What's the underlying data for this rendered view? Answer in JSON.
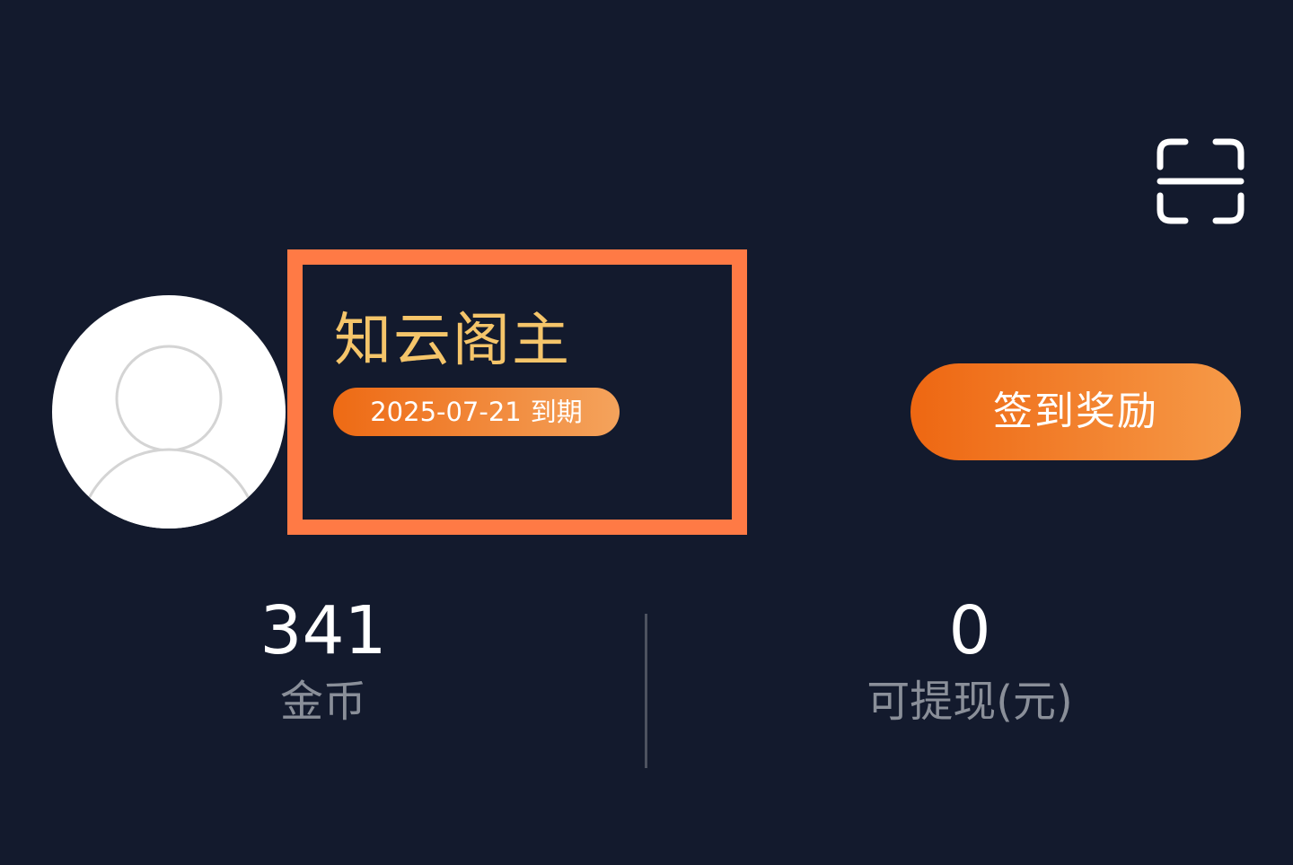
{
  "header": {
    "scan_icon": "scan-icon"
  },
  "profile": {
    "avatar_icon": "default-avatar-icon",
    "username": "知云阁主",
    "expire_date": "2025-07-21",
    "expire_suffix": "到期",
    "checkin_label": "签到奖励"
  },
  "stats": {
    "coins_value": "341",
    "coins_label": "金币",
    "withdrawable_value": "0",
    "withdrawable_label": "可提现(元)"
  },
  "colors": {
    "background": "#131a2d",
    "accent_orange": "#ee6712",
    "highlight_border": "#ff7a45",
    "username_gold": "#f5c56a",
    "label_gray": "#8a8f99"
  }
}
